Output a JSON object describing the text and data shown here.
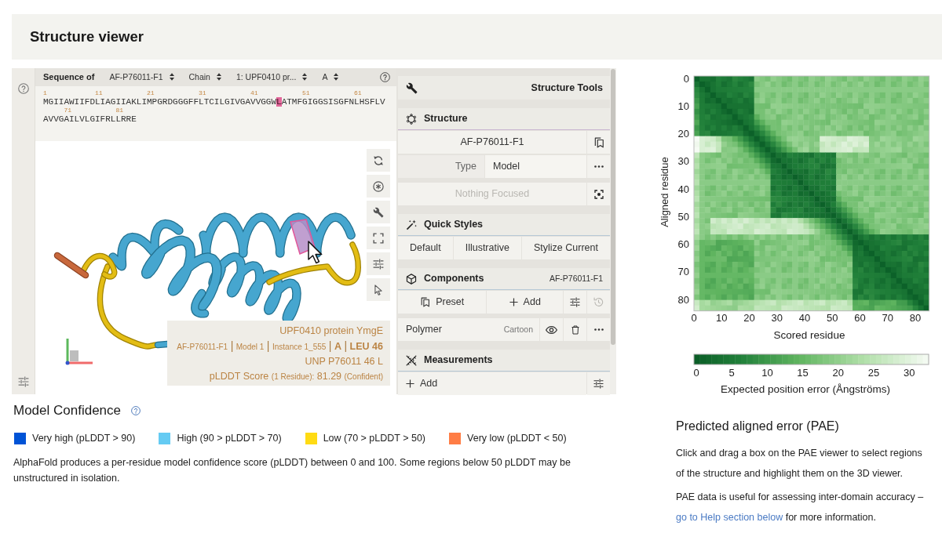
{
  "page_title": "Structure viewer",
  "sequence_panel": {
    "label": "Sequence of",
    "selects": [
      {
        "value": "AF-P76011-F1"
      },
      {
        "value": "Chain"
      },
      {
        "value": "1: UPF0410 pr..."
      },
      {
        "value": "A"
      }
    ],
    "rows": [
      {
        "ruler": [
          "1",
          "11",
          "21",
          "31",
          "41",
          "51",
          "61"
        ],
        "segments": [
          {
            "text": "MGIIAWIIFDLIAGIIAKLIMPGRDGGGFFLTCILGIVGAVVGGW",
            "selected": false
          },
          {
            "text": "L",
            "selected": true
          },
          {
            "text": "ATMFGIGGSISGFNLHSFLV",
            "selected": false
          }
        ]
      },
      {
        "ruler": [
          "71",
          "81"
        ],
        "segments": [
          {
            "text": "AVVGAILVLGIFRLLRRE",
            "selected": false
          }
        ]
      }
    ]
  },
  "viewer": {
    "tools": [
      {
        "kind": "reset"
      },
      {
        "kind": "spin"
      },
      {
        "kind": "settings"
      },
      {
        "kind": "fullscreen"
      },
      {
        "kind": "controls"
      },
      {
        "kind": "select"
      }
    ],
    "hover_info": {
      "title": "UPF0410 protein YmgE",
      "location": [
        {
          "text": "AF-P76011-F1",
          "kind": "minor"
        },
        {
          "text": "|",
          "kind": "separator"
        },
        {
          "text": "Model 1",
          "kind": "minor"
        },
        {
          "text": "|",
          "kind": "separator"
        },
        {
          "text": "Instance 1_555",
          "kind": "minor"
        },
        {
          "text": "|",
          "kind": "separator"
        },
        {
          "text": "A",
          "kind": "major"
        },
        {
          "text": "|",
          "kind": "separator"
        },
        {
          "text": "LEU 46",
          "kind": "major"
        }
      ],
      "mapping": "UNP P76011 46 L",
      "score": [
        {
          "text": "pLDDT Score",
          "kind": "main"
        },
        {
          "text": "(1 Residue):",
          "kind": "minor"
        },
        {
          "text": "81.29",
          "kind": "main"
        },
        {
          "text": "(Confident)",
          "kind": "minor"
        }
      ]
    }
  },
  "structure_tools": {
    "title": "Structure Tools",
    "sections": [
      {
        "kind": "structure",
        "title": "Structure",
        "rows": [
          {
            "kind": "entry",
            "text": "AF-P76011-F1"
          },
          {
            "kind": "field",
            "label": "Type",
            "value": "Model"
          },
          {
            "kind": "focus",
            "text": "Nothing Focused",
            "disabled": true
          }
        ]
      },
      {
        "kind": "quick_styles",
        "title": "Quick Styles",
        "buttons": [
          "Default",
          "Illustrative",
          "Stylize Current"
        ]
      },
      {
        "kind": "components",
        "title": "Components",
        "subtitle": "AF-P76011-F1",
        "actions": [
          {
            "kind": "preset",
            "label": "Preset",
            "disabled": false
          },
          {
            "kind": "add",
            "label": "Add",
            "disabled": false
          },
          {
            "kind": "options",
            "disabled": false
          },
          {
            "kind": "history",
            "disabled": true
          }
        ],
        "items": [
          {
            "label": "Polymer",
            "representation": "Cartoon",
            "visible": true
          }
        ]
      },
      {
        "kind": "measurements",
        "title": "Measurements",
        "actions": [
          {
            "kind": "add",
            "label": "Add",
            "disabled": false
          },
          {
            "kind": "options",
            "disabled": false
          }
        ]
      }
    ]
  },
  "model_confidence": {
    "title": "Model Confidence",
    "legend": [
      {
        "label": "Very high (pLDDT > 90)",
        "color": "#0053d6"
      },
      {
        "label": "High (90 > pLDDT > 70)",
        "color": "#65cbf3"
      },
      {
        "label": "Low (70 > pLDDT > 50)",
        "color": "#ffdb13"
      },
      {
        "label": "Very low (pLDDT < 50)",
        "color": "#ff7d45"
      }
    ],
    "description": "AlphaFold produces a per-residue model confidence score (pLDDT) between 0 and 100. Some regions below 50 pLDDT may be unstructured in isolation."
  },
  "pae": {
    "y_label": "Aligned residue",
    "y_ticks": [
      "0",
      "10",
      "20",
      "30",
      "40",
      "50",
      "60",
      "70",
      "80"
    ],
    "x_ticks": [
      "0",
      "10",
      "20",
      "30",
      "40",
      "50",
      "60",
      "70",
      "80"
    ],
    "x_label": "Scored residue",
    "colorbar": {
      "ticks": [
        "0",
        "5",
        "10",
        "15",
        "20",
        "25",
        "30"
      ],
      "label": "Expected position error (Ångströms)"
    },
    "title": "Predicted aligned error (PAE)",
    "paragraphs": [
      {
        "text": "Click and drag a box on the PAE viewer to select regions of the structure and highlight them on the 3D viewer."
      },
      {
        "text": "PAE data is useful for assessing inter-domain accuracy –",
        "link": "go to Help section below",
        "after": "for more information."
      }
    ]
  }
}
